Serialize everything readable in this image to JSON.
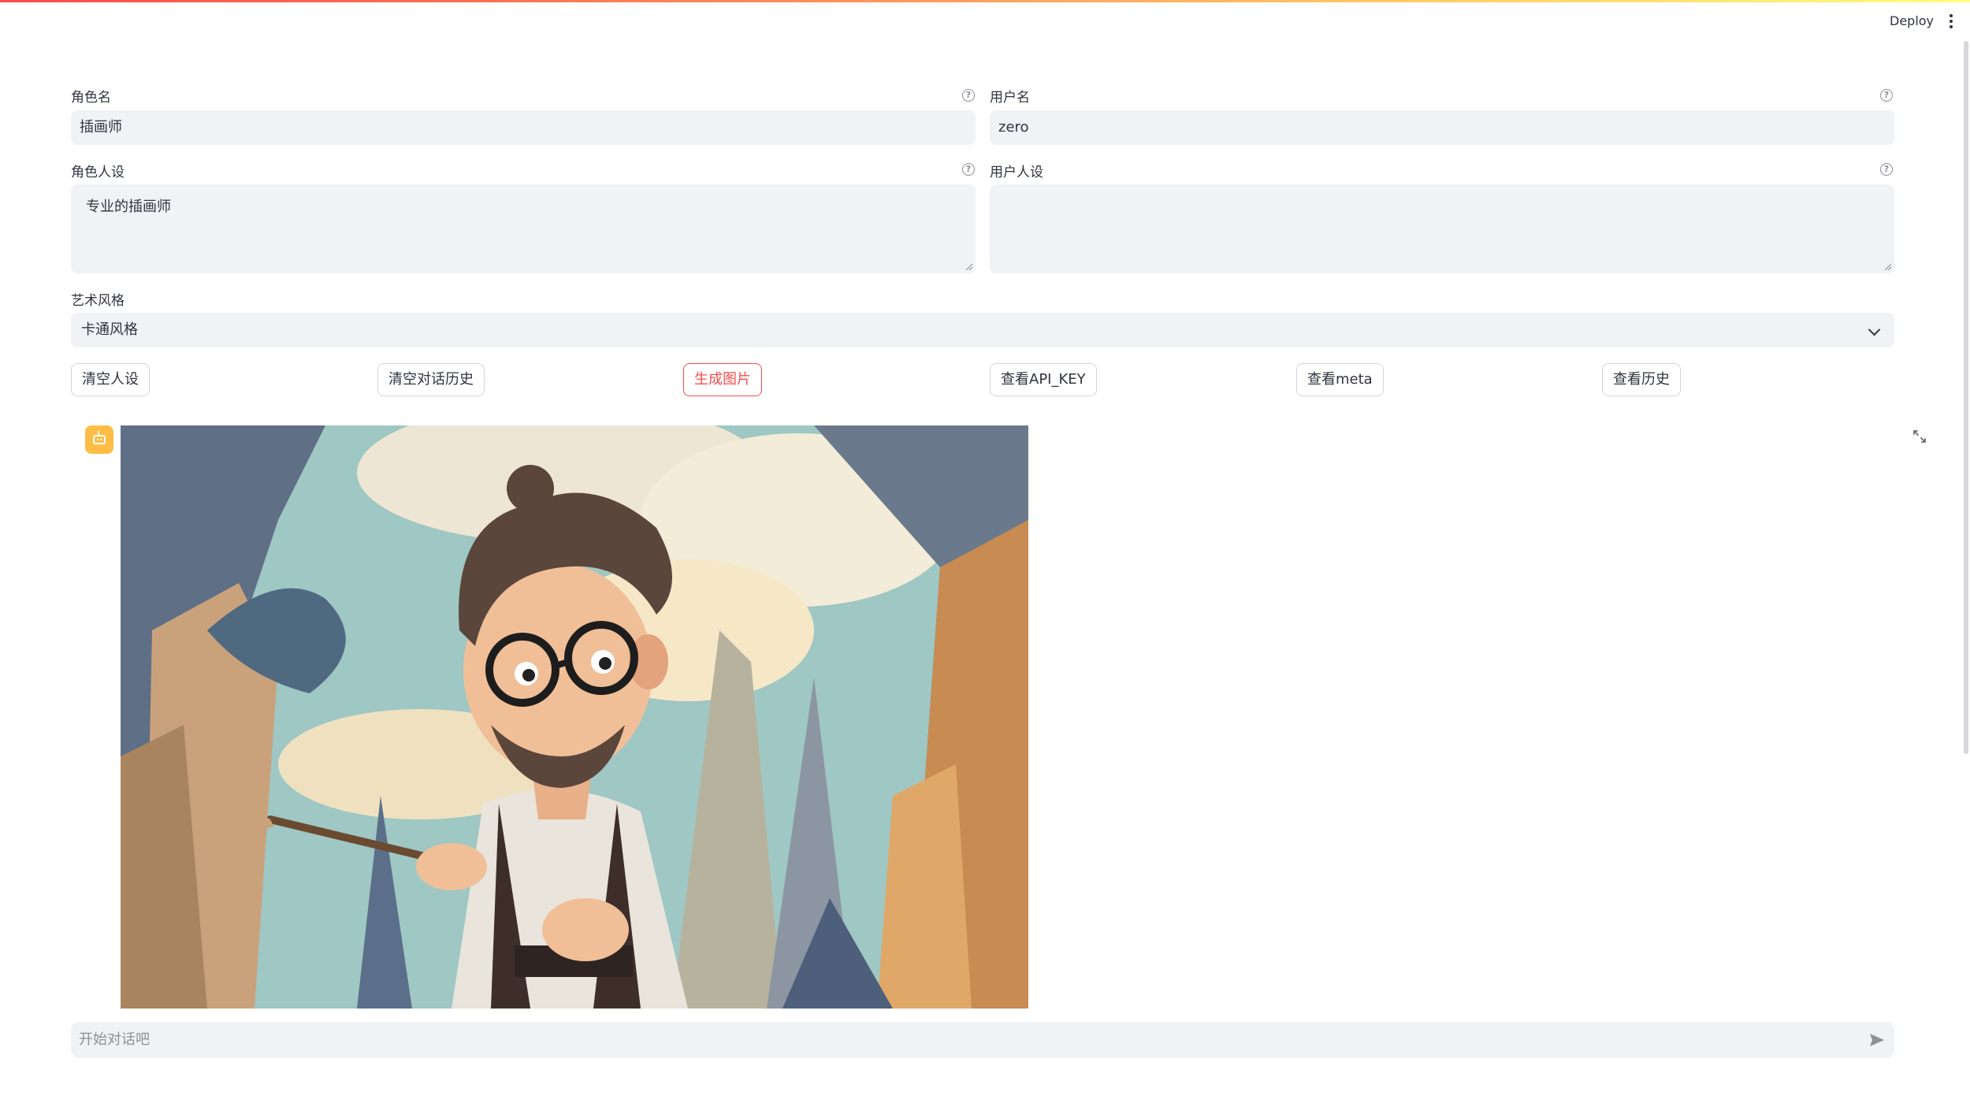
{
  "app": {
    "deploy_label": "Deploy",
    "menu_icon": "more-vertical-icon"
  },
  "form": {
    "role_name": {
      "label": "角色名",
      "value": "插画师"
    },
    "user_name": {
      "label": "用户名",
      "value": "zero"
    },
    "role_persona": {
      "label": "角色人设",
      "value": "专业的插画师"
    },
    "user_persona": {
      "label": "用户人设",
      "value": ""
    },
    "art_style": {
      "label": "艺术风格",
      "selected": "卡通风格"
    }
  },
  "buttons": {
    "clear_persona": "清空人设",
    "clear_history": "清空对话历史",
    "generate_image": "生成图片",
    "view_api_key": "查看API_KEY",
    "view_meta": "查看meta",
    "view_history": "查看历史"
  },
  "chat": {
    "avatar_icon": "bot-icon",
    "image_alt": "cartoon illustration of a painter with glasses holding a brush",
    "input_placeholder": "开始对话吧",
    "send_icon": "send-icon"
  },
  "colors": {
    "accent": "#ff4b4b",
    "avatar": "#ffbd45",
    "field_bg": "#f0f2f6"
  }
}
